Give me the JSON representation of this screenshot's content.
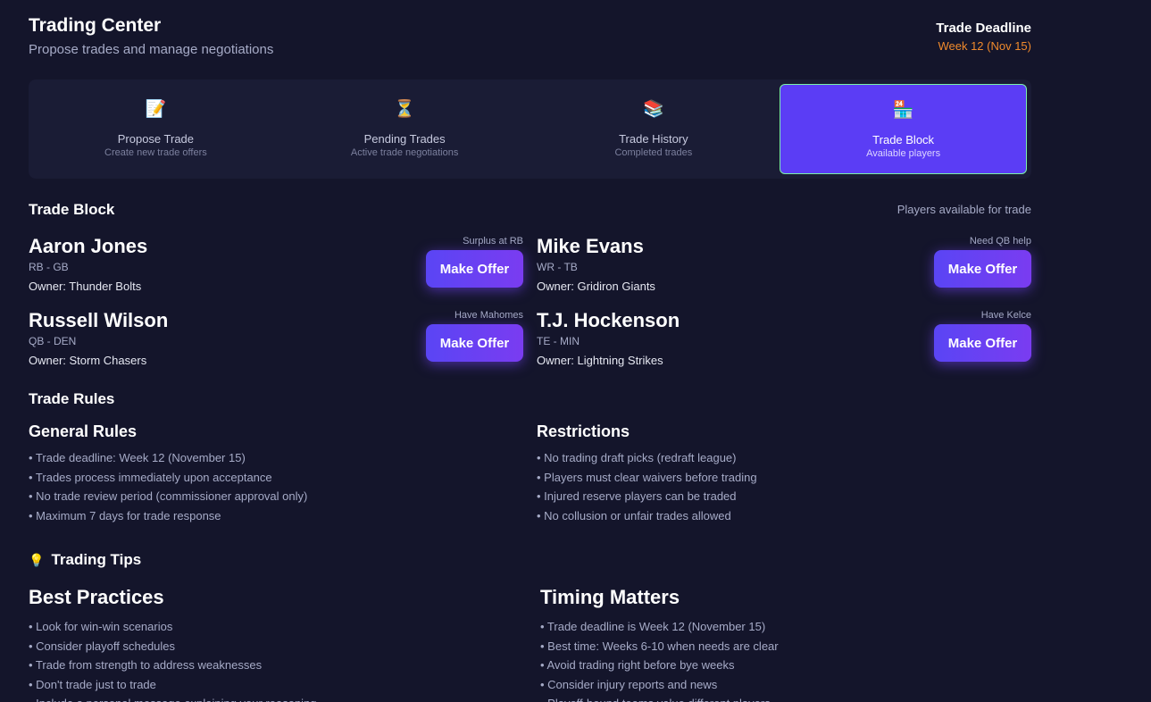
{
  "header": {
    "title": "Trading Center",
    "subtitle": "Propose trades and manage negotiations",
    "deadline_label": "Trade Deadline",
    "deadline_value": "Week 12 (Nov 15)"
  },
  "tabs": [
    {
      "icon": "📝",
      "icon_name": "memo-pencil-icon",
      "label": "Propose Trade",
      "sub": "Create new trade offers",
      "active": false
    },
    {
      "icon": "⏳",
      "icon_name": "hourglass-icon",
      "label": "Pending Trades",
      "sub": "Active trade negotiations",
      "active": false
    },
    {
      "icon": "📚",
      "icon_name": "books-icon",
      "label": "Trade History",
      "sub": "Completed trades",
      "active": false
    },
    {
      "icon": "🏪",
      "icon_name": "store-icon",
      "label": "Trade Block",
      "sub": "Available players",
      "active": true
    }
  ],
  "trade_block": {
    "title": "Trade Block",
    "note": "Players available for trade",
    "button_label": "Make Offer",
    "players": [
      {
        "name": "Aaron Jones",
        "pos": "RB - GB",
        "owner": "Owner: Thunder Bolts",
        "note": "Surplus at RB"
      },
      {
        "name": "Mike Evans",
        "pos": "WR - TB",
        "owner": "Owner: Gridiron Giants",
        "note": "Need QB help"
      },
      {
        "name": "Russell Wilson",
        "pos": "QB - DEN",
        "owner": "Owner: Storm Chasers",
        "note": "Have Mahomes"
      },
      {
        "name": "T.J. Hockenson",
        "pos": "TE - MIN",
        "owner": "Owner: Lightning Strikes",
        "note": "Have Kelce"
      }
    ]
  },
  "trade_rules": {
    "title": "Trade Rules",
    "general": {
      "heading": "General Rules",
      "items": [
        "• Trade deadline: Week 12 (November 15)",
        "• Trades process immediately upon acceptance",
        "• No trade review period (commissioner approval only)",
        "• Maximum 7 days for trade response"
      ]
    },
    "restrictions": {
      "heading": "Restrictions",
      "items": [
        "• No trading draft picks (redraft league)",
        "• Players must clear waivers before trading",
        "• Injured reserve players can be traded",
        "• No collusion or unfair trades allowed"
      ]
    }
  },
  "trading_tips": {
    "icon": "💡",
    "icon_name": "lightbulb-icon",
    "title": "Trading Tips",
    "best_practices": {
      "heading": "Best Practices",
      "items": [
        "• Look for win-win scenarios",
        "• Consider playoff schedules",
        "• Trade from strength to address weaknesses",
        "• Don't trade just to trade",
        "• Include a personal message explaining your reasoning"
      ]
    },
    "timing": {
      "heading": "Timing Matters",
      "items": [
        "• Trade deadline is Week 12 (November 15)",
        "• Best time: Weeks 6-10 when needs are clear",
        "• Avoid trading right before bye weeks",
        "• Consider injury reports and news",
        "• Playoff-bound teams value different players"
      ]
    }
  },
  "colors": {
    "background": "#14152b",
    "panel": "#1a1c35",
    "accent": "#5b3df5",
    "active_border": "#7cf0a8",
    "deadline": "#f08a2c"
  }
}
